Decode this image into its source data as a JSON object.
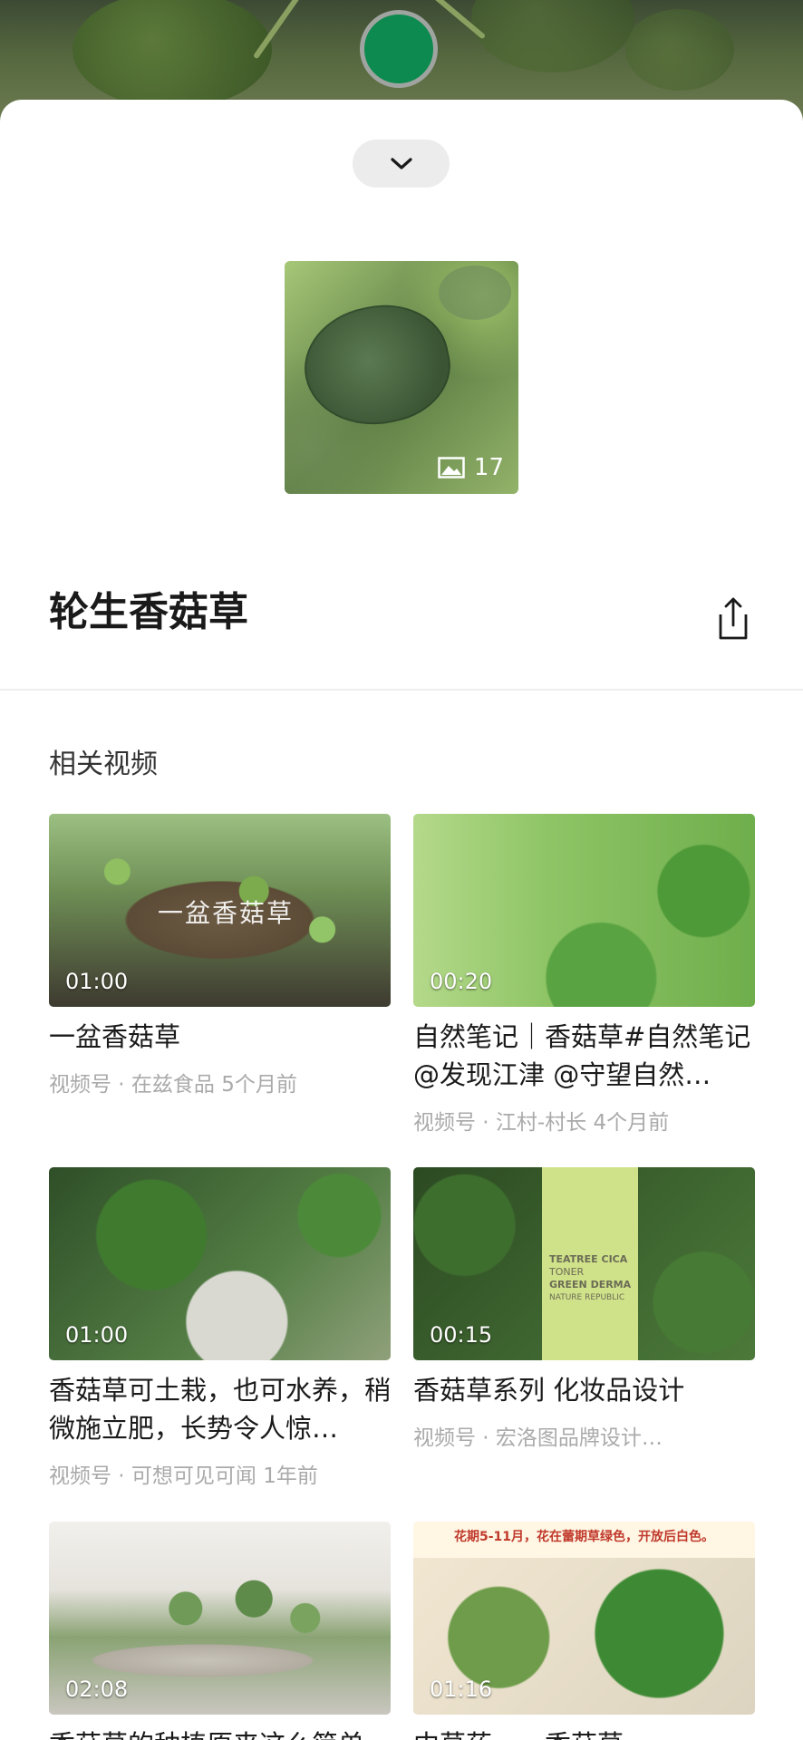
{
  "header": {
    "collapse_icon": "chevron-down-icon"
  },
  "hero": {
    "image_count": "17",
    "image_icon": "image-icon"
  },
  "title": "轮生香菇草",
  "share_icon": "share-icon",
  "related": {
    "section_title": "相关视频",
    "videos": [
      {
        "duration": "01:00",
        "title": "一盆香菇草",
        "meta": "视频号 · 在兹食品   5个月前",
        "overlay_text": "一盆香菇草"
      },
      {
        "duration": "00:20",
        "title": "自然笔记｜香菇草#自然笔记@发现江津 @守望自然…",
        "meta": "视频号 · 江村-村长   4个月前"
      },
      {
        "duration": "01:00",
        "title": "香菇草可土栽，也可水养，稍微施立肥，长势令人惊…",
        "meta": "视频号 · 可想可见可闻   1年前"
      },
      {
        "duration": "00:15",
        "title": "香菇草系列 化妆品设计",
        "meta": "视频号 · 宏洛图品牌设计…",
        "bottle_lines": [
          "TEATREE CICA",
          "TONER",
          "GREEN DERMA",
          "NATURE REPUBLIC"
        ]
      },
      {
        "duration": "02:08",
        "title": "香菇草的种植原来这么简单",
        "meta": ""
      },
      {
        "duration": "01:16",
        "title": "中草药——香菇草",
        "meta": "",
        "banner": "花期5-11月，花在蕾期草绿色，开放后白色。"
      }
    ]
  },
  "colors": {
    "accent_green": "#0d8a4f",
    "meta_gray": "#aaaaaa"
  }
}
